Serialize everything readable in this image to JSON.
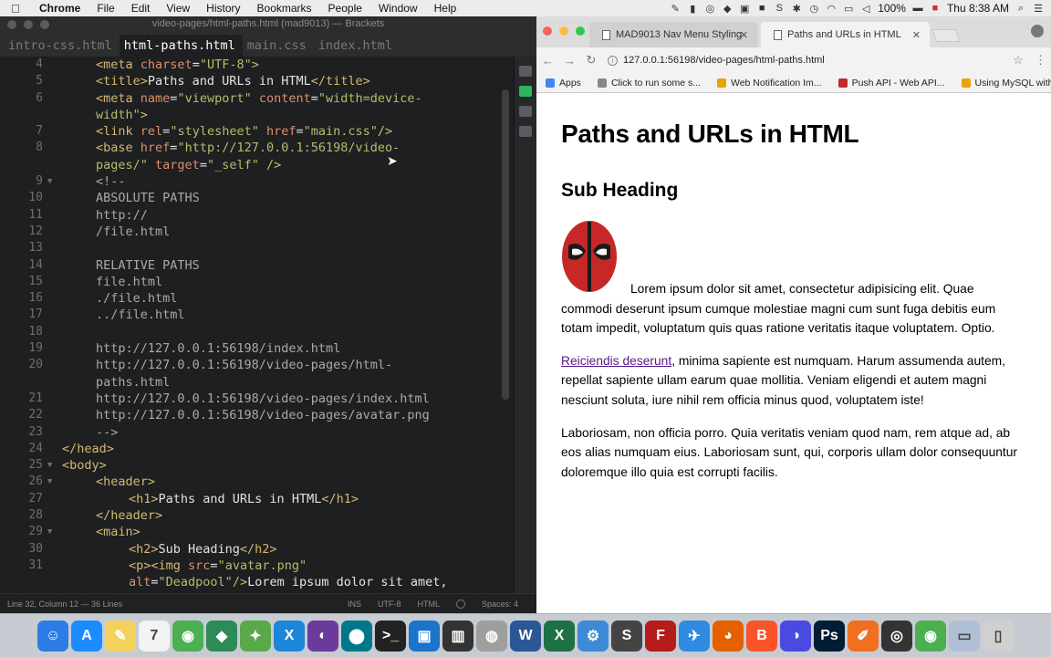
{
  "menubar": {
    "app": "Chrome",
    "items": [
      "File",
      "Edit",
      "View",
      "History",
      "Bookmarks",
      "People",
      "Window",
      "Help"
    ],
    "battery": "100%",
    "clock": "Thu 8:38 AM"
  },
  "editor": {
    "title": "video-pages/html-paths.html (mad9013) — Brackets",
    "tabs": [
      "intro-css.html",
      "html-paths.html",
      "main.css",
      "index.html"
    ],
    "active_tab": 1,
    "lines": [
      {
        "n": "4",
        "fold": "",
        "spans": [
          [
            "t-tag",
            "<meta "
          ],
          [
            "t-attr",
            "charset"
          ],
          [
            "t-txt",
            "="
          ],
          [
            "t-str",
            "\"UTF-8\""
          ],
          [
            "t-tag",
            ">"
          ]
        ]
      },
      {
        "n": "5",
        "fold": "",
        "spans": [
          [
            "t-tag",
            "<title>"
          ],
          [
            "t-txt",
            "Paths and URLs in HTML"
          ],
          [
            "t-tag",
            "</title>"
          ]
        ]
      },
      {
        "n": "6",
        "fold": "",
        "spans": [
          [
            "t-tag",
            "<meta "
          ],
          [
            "t-attr",
            "name"
          ],
          [
            "t-txt",
            "="
          ],
          [
            "t-str",
            "\"viewport\" "
          ],
          [
            "t-attr",
            "content"
          ],
          [
            "t-txt",
            "="
          ],
          [
            "t-str",
            "\"width=device-"
          ]
        ]
      },
      {
        "n": "",
        "fold": "",
        "spans": [
          [
            "t-str",
            "width\""
          ],
          [
            "t-tag",
            ">"
          ]
        ]
      },
      {
        "n": "7",
        "fold": "",
        "spans": [
          [
            "t-tag",
            "<link "
          ],
          [
            "t-attr",
            "rel"
          ],
          [
            "t-txt",
            "="
          ],
          [
            "t-str",
            "\"stylesheet\" "
          ],
          [
            "t-attr",
            "href"
          ],
          [
            "t-txt",
            "="
          ],
          [
            "t-str",
            "\"main.css\""
          ],
          [
            "t-tag",
            "/>"
          ]
        ]
      },
      {
        "n": "8",
        "fold": "",
        "spans": [
          [
            "t-tag",
            "<base "
          ],
          [
            "t-attr",
            "href"
          ],
          [
            "t-txt",
            "="
          ],
          [
            "t-str",
            "\"http://127.0.0.1:56198/video-"
          ]
        ]
      },
      {
        "n": "",
        "fold": "",
        "spans": [
          [
            "t-str",
            "pages/\" "
          ],
          [
            "t-attr",
            "target"
          ],
          [
            "t-txt",
            "="
          ],
          [
            "t-str",
            "\"_self\" "
          ],
          [
            "t-tag",
            "/>"
          ]
        ]
      },
      {
        "n": "9",
        "fold": "▼",
        "spans": [
          [
            "t-com",
            "<!--"
          ]
        ]
      },
      {
        "n": "10",
        "fold": "",
        "spans": [
          [
            "t-com",
            "ABSOLUTE PATHS"
          ]
        ]
      },
      {
        "n": "11",
        "fold": "",
        "spans": [
          [
            "t-com",
            "http://"
          ]
        ]
      },
      {
        "n": "12",
        "fold": "",
        "spans": [
          [
            "t-com",
            "/file.html"
          ]
        ]
      },
      {
        "n": "13",
        "fold": "",
        "spans": []
      },
      {
        "n": "14",
        "fold": "",
        "spans": [
          [
            "t-com",
            "RELATIVE PATHS"
          ]
        ]
      },
      {
        "n": "15",
        "fold": "",
        "spans": [
          [
            "t-com",
            "file.html"
          ]
        ]
      },
      {
        "n": "16",
        "fold": "",
        "spans": [
          [
            "t-com",
            "./file.html"
          ]
        ]
      },
      {
        "n": "17",
        "fold": "",
        "spans": [
          [
            "t-com",
            "../file.html"
          ]
        ]
      },
      {
        "n": "18",
        "fold": "",
        "spans": []
      },
      {
        "n": "19",
        "fold": "",
        "spans": [
          [
            "t-com",
            "http://127.0.0.1:56198/index.html"
          ]
        ]
      },
      {
        "n": "20",
        "fold": "",
        "spans": [
          [
            "t-com",
            "http://127.0.0.1:56198/video-pages/html-"
          ]
        ]
      },
      {
        "n": "",
        "fold": "",
        "spans": [
          [
            "t-com",
            "paths.html"
          ]
        ]
      },
      {
        "n": "21",
        "fold": "",
        "spans": [
          [
            "t-com",
            "http://127.0.0.1:56198/video-pages/index.html"
          ]
        ]
      },
      {
        "n": "22",
        "fold": "",
        "spans": [
          [
            "t-com",
            "http://127.0.0.1:56198/video-pages/avatar.png"
          ]
        ]
      },
      {
        "n": "23",
        "fold": "",
        "spans": [
          [
            "t-com",
            "-->"
          ]
        ]
      },
      {
        "n": "24",
        "fold": "",
        "outdent": true,
        "spans": [
          [
            "t-tag",
            "</head>"
          ]
        ]
      },
      {
        "n": "25",
        "fold": "▼",
        "outdent": true,
        "spans": [
          [
            "t-tag",
            "<body>"
          ]
        ]
      },
      {
        "n": "26",
        "fold": "▼",
        "spans": [
          [
            "t-tag",
            "<header>"
          ]
        ]
      },
      {
        "n": "27",
        "fold": "",
        "indent": true,
        "spans": [
          [
            "t-tag",
            "<h1>"
          ],
          [
            "t-txt",
            "Paths and URLs in HTML"
          ],
          [
            "t-tag",
            "</h1>"
          ]
        ]
      },
      {
        "n": "28",
        "fold": "",
        "spans": [
          [
            "t-tag",
            "</header>"
          ]
        ]
      },
      {
        "n": "29",
        "fold": "▼",
        "spans": [
          [
            "t-tag",
            "<main>"
          ]
        ]
      },
      {
        "n": "30",
        "fold": "",
        "indent": true,
        "spans": [
          [
            "t-tag",
            "<h2>"
          ],
          [
            "t-txt",
            "Sub Heading"
          ],
          [
            "t-tag",
            "</h2>"
          ]
        ]
      },
      {
        "n": "31",
        "fold": "",
        "indent": true,
        "spans": [
          [
            "t-tag",
            "<p><img "
          ],
          [
            "t-attr",
            "src"
          ],
          [
            "t-txt",
            "="
          ],
          [
            "t-str",
            "\"avatar.png\""
          ]
        ]
      },
      {
        "n": "",
        "fold": "",
        "indent": true,
        "spans": [
          [
            "t-attr",
            "alt"
          ],
          [
            "t-txt",
            "="
          ],
          [
            "t-str",
            "\"Deadpool\""
          ],
          [
            "t-tag",
            "/>"
          ],
          [
            "t-txt",
            "Lorem ipsum dolor sit amet,"
          ]
        ]
      }
    ],
    "status_left": "Line 32, Column 12 — 36 Lines",
    "status_ins": "INS",
    "status_enc": "UTF-8",
    "status_lang": "HTML",
    "status_spaces": "Spaces: 4"
  },
  "chrome": {
    "tabs": [
      {
        "label": "MAD9013 Nav Menu Styling"
      },
      {
        "label": "Paths and URLs in HTML"
      }
    ],
    "url": "127.0.0.1:56198/video-pages/html-paths.html",
    "bookmarks": [
      {
        "label": "Apps",
        "color": "#4285f4"
      },
      {
        "label": "Click to run some s...",
        "color": "#888888"
      },
      {
        "label": "Web Notification Im...",
        "color": "#e8a400"
      },
      {
        "label": "Push API - Web API...",
        "color": "#c62828"
      },
      {
        "label": "Using MySQL with...",
        "color": "#e8a400"
      }
    ],
    "page": {
      "h1": "Paths and URLs in HTML",
      "h2": "Sub Heading",
      "p1": "Lorem ipsum dolor sit amet, consectetur adipisicing elit. Quae commodi deserunt ipsum cumque molestiae magni cum sunt fuga debitis eum totam impedit, voluptatum quis quas ratione veritatis itaque voluptatem. Optio.",
      "p2_link": "Reiciendis deserunt",
      "p2_rest": ", minima sapiente est numquam. Harum assumenda autem, repellat sapiente ullam earum quae mollitia. Veniam eligendi et autem magni nesciunt soluta, iure nihil rem officia minus quod, voluptatem iste!",
      "p3": "Laboriosam, non officia porro. Quia veritatis veniam quod nam, rem atque ad, ab eos alias numquam eius. Laboriosam sunt, qui, corporis ullam dolor consequuntur doloremque illo quia est corrupti facilis."
    }
  },
  "dock": [
    {
      "label": "☺",
      "color": "#2d7be5"
    },
    {
      "label": "A",
      "color": "#1a8cff"
    },
    {
      "label": "✎",
      "color": "#f2d25a"
    },
    {
      "label": "7",
      "color": "#f3f3f3"
    },
    {
      "label": "◉",
      "color": "#4caf50"
    },
    {
      "label": "◆",
      "color": "#2e8b57"
    },
    {
      "label": "✦",
      "color": "#5aa84a"
    },
    {
      "label": "X",
      "color": "#1c86d8"
    },
    {
      "label": "◐",
      "color": "#6a3a9c"
    },
    {
      "label": "⬤",
      "color": "#00788a"
    },
    {
      "label": ">_",
      "color": "#222222"
    },
    {
      "label": "▣",
      "color": "#1a74c9"
    },
    {
      "label": "▥",
      "color": "#333333"
    },
    {
      "label": "◍",
      "color": "#9e9e9e"
    },
    {
      "label": "W",
      "color": "#2b5797"
    },
    {
      "label": "X",
      "color": "#1e7145"
    },
    {
      "label": "⚙",
      "color": "#3d8bd4"
    },
    {
      "label": "S",
      "color": "#444444"
    },
    {
      "label": "F",
      "color": "#b71c1c"
    },
    {
      "label": "✈",
      "color": "#2f8be0"
    },
    {
      "label": "◕",
      "color": "#e66000"
    },
    {
      "label": "B",
      "color": "#fb542b"
    },
    {
      "label": "◑",
      "color": "#4a4ae0"
    },
    {
      "label": "Ps",
      "color": "#001d34"
    },
    {
      "label": "✐",
      "color": "#f07020"
    },
    {
      "label": "◎",
      "color": "#333333"
    },
    {
      "label": "◉",
      "color": "#4caf50"
    },
    {
      "label": "▭",
      "color": "#aebfd6"
    },
    {
      "label": "▯",
      "color": "#d0d0d0"
    }
  ]
}
